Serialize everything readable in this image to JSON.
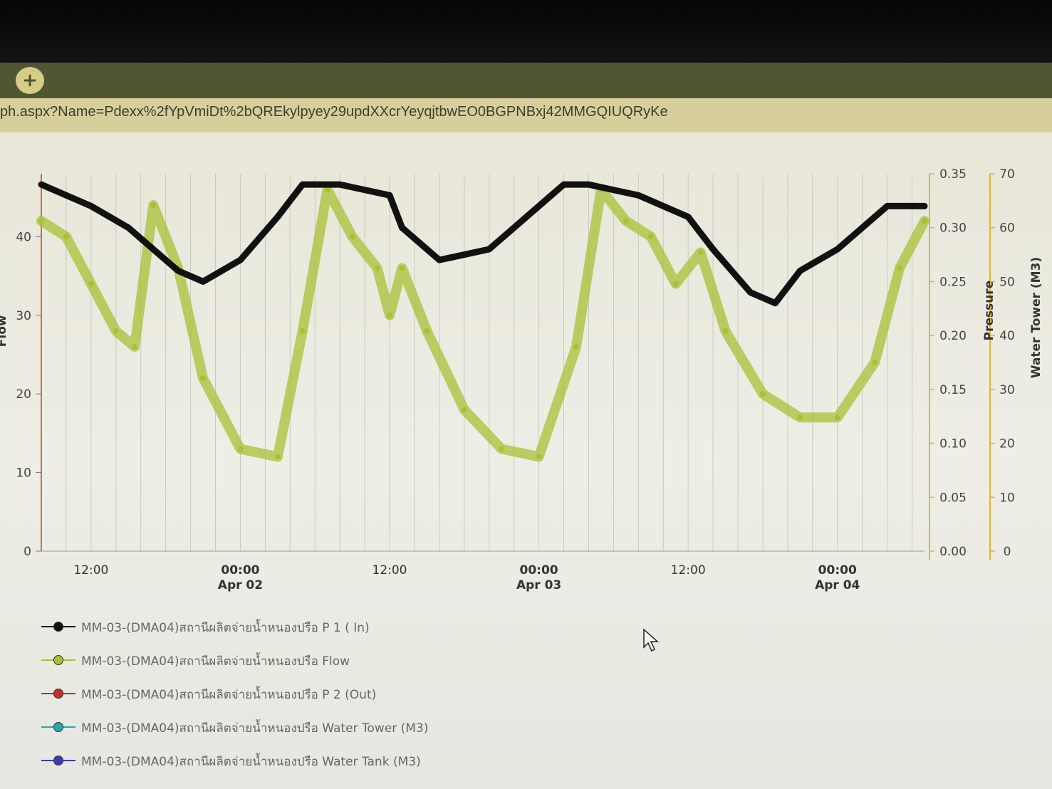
{
  "browser": {
    "new_tab_label": "+",
    "url": "ph.aspx?Name=Pdexx%2fYpVmiDt%2bQREkylpyey29updXXcrYeyqjtbwEO0BGPNBxj42MMGQIUQRyKe"
  },
  "colors": {
    "flow": "#a8c036",
    "p1": "#111111",
    "p2": "#c0302a",
    "tower": "#2aa8b0",
    "tank": "#3b3bb8",
    "axis_accent": "#e7b42a",
    "left_axis_line": "#e8623c"
  },
  "chart_data": {
    "type": "line",
    "title": "",
    "x_ticks": [
      {
        "time": "Apr 01 12:00",
        "label": "12:00",
        "sub": ""
      },
      {
        "time": "Apr 02 00:00",
        "label": "00:00",
        "sub": "Apr 02"
      },
      {
        "time": "Apr 02 12:00",
        "label": "12:00",
        "sub": ""
      },
      {
        "time": "Apr 03 00:00",
        "label": "00:00",
        "sub": "Apr 03"
      },
      {
        "time": "Apr 03 12:00",
        "label": "12:00",
        "sub": ""
      },
      {
        "time": "Apr 04 00:00",
        "label": "00:00",
        "sub": "Apr 04"
      }
    ],
    "xrange": [
      "Apr 01 08:00",
      "Apr 04 07:00"
    ],
    "axes": [
      {
        "id": "flow",
        "title": "Flow",
        "position": "left",
        "range": [
          0,
          48
        ],
        "ticks": [
          "0",
          "10",
          "20",
          "30",
          "40"
        ],
        "tick_values": [
          0,
          10,
          20,
          30,
          40
        ]
      },
      {
        "id": "pressure",
        "title": "Pressure",
        "position": "right",
        "range": [
          0,
          0.35
        ],
        "ticks": [
          "0.00",
          "0.05",
          "0.10",
          "0.15",
          "0.20",
          "0.25",
          "0.30",
          "0.35"
        ],
        "tick_values": [
          0,
          0.05,
          0.1,
          0.15,
          0.2,
          0.25,
          0.3,
          0.35
        ]
      },
      {
        "id": "tower",
        "title": "Water Tower (M3)",
        "position": "right",
        "range": [
          0,
          70
        ],
        "ticks": [
          "0",
          "10",
          "20",
          "30",
          "40",
          "50",
          "60",
          "70"
        ],
        "tick_values": [
          0,
          10,
          20,
          30,
          40,
          50,
          60,
          70
        ]
      }
    ],
    "series": [
      {
        "name": "MM-03-(DMA04)สถานีผลิตจ่ายน้ำหนองปรือ P 1 ( In)",
        "axis": "pressure",
        "color": "#111111",
        "x": [
          "Apr 01 08:00",
          "Apr 01 12:00",
          "Apr 01 15:00",
          "Apr 01 19:00",
          "Apr 01 21:00",
          "Apr 02 00:00",
          "Apr 02 03:00",
          "Apr 02 05:00",
          "Apr 02 08:00",
          "Apr 02 12:00",
          "Apr 02 13:00",
          "Apr 02 16:00",
          "Apr 02 20:00",
          "Apr 03 00:00",
          "Apr 03 02:00",
          "Apr 03 04:00",
          "Apr 03 08:00",
          "Apr 03 12:00",
          "Apr 03 14:00",
          "Apr 03 17:00",
          "Apr 03 19:00",
          "Apr 03 21:00",
          "Apr 04 00:00",
          "Apr 04 02:00",
          "Apr 04 04:00",
          "Apr 04 06:00",
          "Apr 04 07:00"
        ],
        "values": [
          0.34,
          0.32,
          0.3,
          0.26,
          0.25,
          0.27,
          0.31,
          0.34,
          0.34,
          0.33,
          0.3,
          0.27,
          0.28,
          0.32,
          0.34,
          0.34,
          0.33,
          0.31,
          0.28,
          0.24,
          0.23,
          0.26,
          0.28,
          0.3,
          0.32,
          0.32,
          0.32
        ]
      },
      {
        "name": "MM-03-(DMA04)สถานีผลิตจ่ายน้ำหนองปรือ Flow",
        "axis": "flow",
        "color": "#a8c036",
        "x": [
          "Apr 01 08:00",
          "Apr 01 10:00",
          "Apr 01 12:00",
          "Apr 01 14:00",
          "Apr 01 15:30",
          "Apr 01 17:00",
          "Apr 01 19:00",
          "Apr 01 21:00",
          "Apr 02 00:00",
          "Apr 02 03:00",
          "Apr 02 05:00",
          "Apr 02 07:00",
          "Apr 02 09:00",
          "Apr 02 11:00",
          "Apr 02 12:00",
          "Apr 02 13:00",
          "Apr 02 15:00",
          "Apr 02 18:00",
          "Apr 02 21:00",
          "Apr 03 00:00",
          "Apr 03 03:00",
          "Apr 03 05:00",
          "Apr 03 07:00",
          "Apr 03 09:00",
          "Apr 03 11:00",
          "Apr 03 13:00",
          "Apr 03 15:00",
          "Apr 03 18:00",
          "Apr 03 21:00",
          "Apr 04 00:00",
          "Apr 04 03:00",
          "Apr 04 05:00",
          "Apr 04 07:00"
        ],
        "values": [
          42,
          40,
          34,
          28,
          26,
          44,
          36,
          22,
          13,
          12,
          28,
          46,
          40,
          36,
          30,
          36,
          28,
          18,
          13,
          12,
          26,
          46,
          42,
          40,
          34,
          38,
          28,
          20,
          17,
          17,
          24,
          36,
          42
        ]
      },
      {
        "name": "MM-03-(DMA04)สถานีผลิตจ่ายน้ำหนองปรือ P 2 (Out)",
        "axis": "pressure",
        "color": "#c0302a",
        "x": [],
        "values": []
      },
      {
        "name": "MM-03-(DMA04)สถานีผลิตจ่ายน้ำหนองปรือ Water Tower (M3)",
        "axis": "tower",
        "color": "#2aa8b0",
        "x": [],
        "values": []
      },
      {
        "name": "MM-03-(DMA04)สถานีผลิตจ่ายน้ำหนองปรือ Water Tank (M3)",
        "axis": "tower",
        "color": "#3b3bb8",
        "x": [],
        "values": []
      }
    ]
  }
}
